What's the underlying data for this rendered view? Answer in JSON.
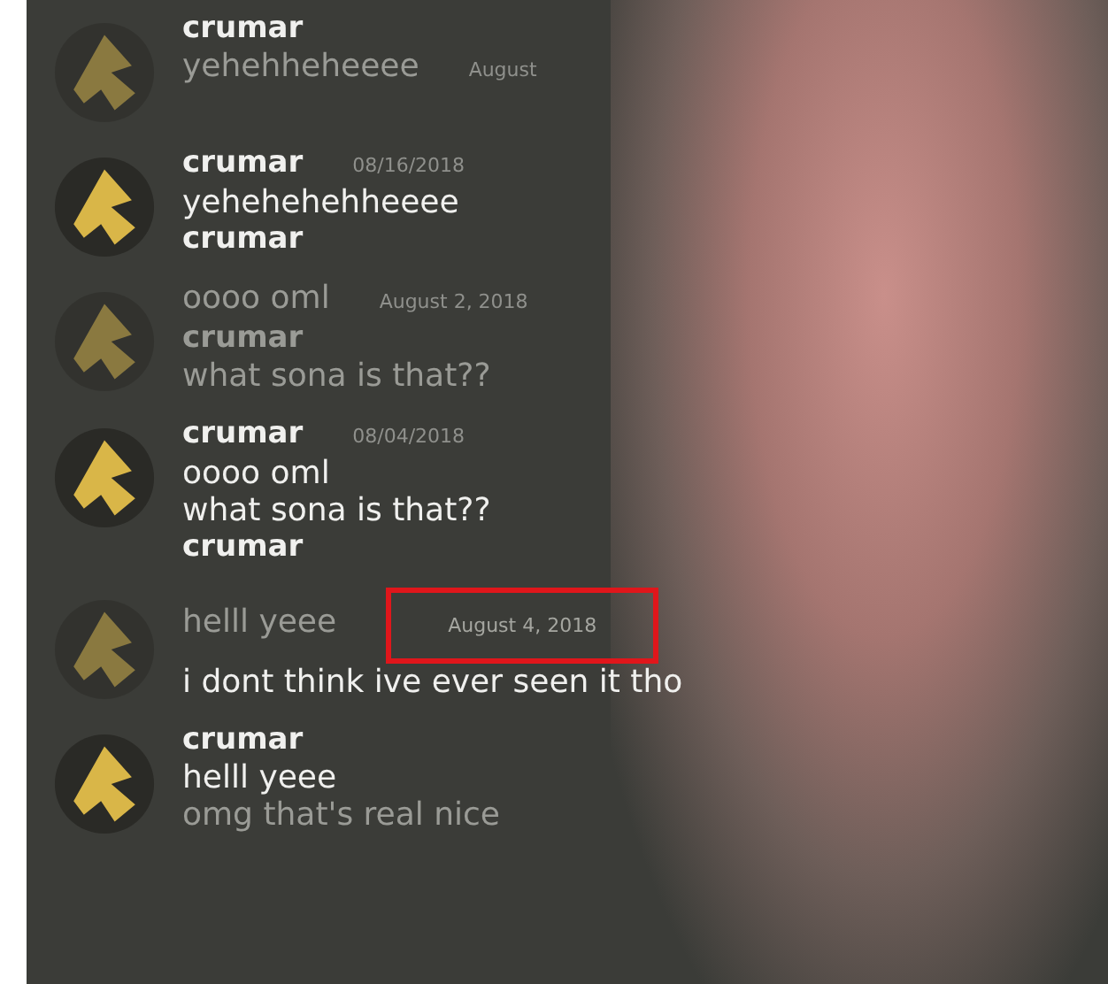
{
  "messages": [
    {
      "avatar": {
        "faded": true
      },
      "lines": [
        {
          "kind": "name",
          "text": "crumar",
          "faded": false
        },
        {
          "kind": "message",
          "text": "yehehheheeee",
          "faded": true,
          "date": "August"
        }
      ]
    },
    {
      "avatar": {
        "faded": false
      },
      "lines": [
        {
          "kind": "name",
          "text": "crumar",
          "faded": false,
          "date": "08/16/2018"
        },
        {
          "kind": "message",
          "text": "yehehehehheeee",
          "faded": false
        },
        {
          "kind": "name",
          "text": "crumar",
          "faded": false
        }
      ]
    },
    {
      "avatar": {
        "faded": true
      },
      "lines": [
        {
          "kind": "message",
          "text": "oooo oml",
          "faded": true,
          "date": "August 2, 2018"
        },
        {
          "kind": "name",
          "text": "crumar",
          "faded": true
        },
        {
          "kind": "message",
          "text": "what sona is that??",
          "faded": true
        }
      ]
    },
    {
      "avatar": {
        "faded": false
      },
      "lines": [
        {
          "kind": "name",
          "text": "crumar",
          "faded": false,
          "date": "08/04/2018"
        },
        {
          "kind": "message",
          "text": "oooo oml",
          "faded": false
        },
        {
          "kind": "message",
          "text": "what sona is that??",
          "faded": false
        },
        {
          "kind": "name",
          "text": "crumar",
          "faded": false
        }
      ]
    },
    {
      "avatar": {
        "faded": true
      },
      "lines": [
        {
          "kind": "message",
          "text": "helll yeee",
          "faded": true,
          "date": "August 4, 2018",
          "highlighted": true
        },
        {
          "kind": "message",
          "text": "i dont think ive ever seen it tho",
          "faded": false
        }
      ]
    },
    {
      "avatar": {
        "faded": false
      },
      "lines": [
        {
          "kind": "name",
          "text": "crumar",
          "faded": false
        },
        {
          "kind": "message",
          "text": "helll yeee",
          "faded": false
        },
        {
          "kind": "message",
          "text": "omg that's real nice",
          "faded": true
        }
      ]
    }
  ]
}
